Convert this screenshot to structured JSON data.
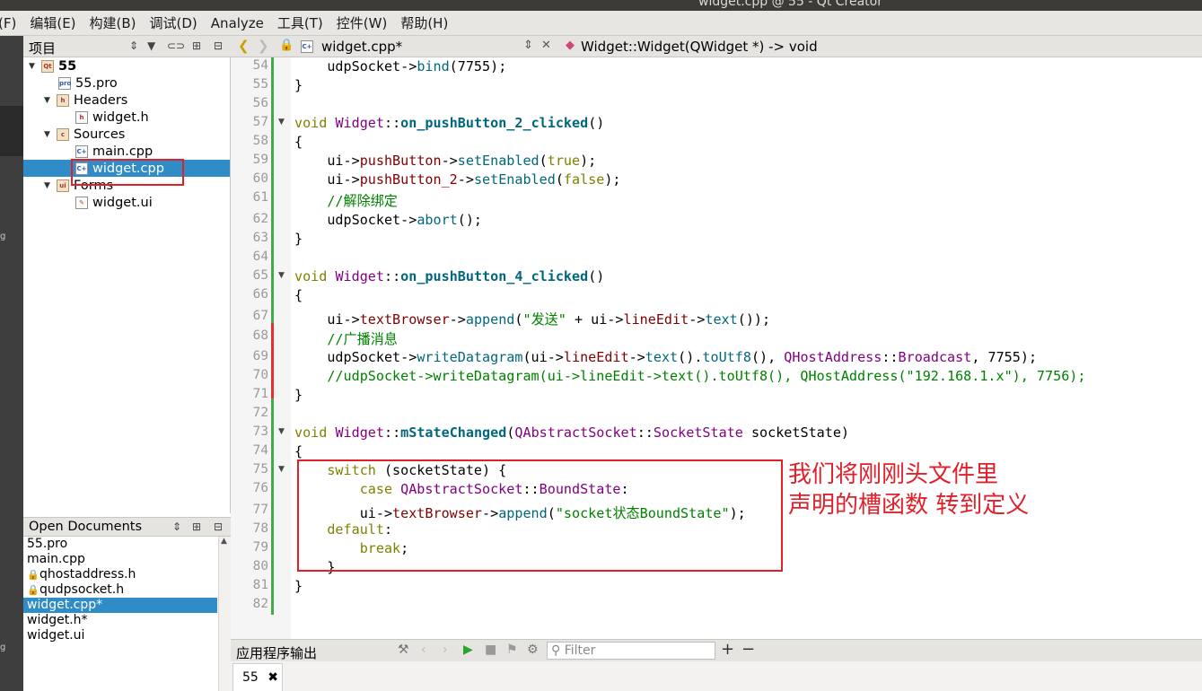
{
  "window": {
    "title": "widget.cpp @ 55 - Qt Creator"
  },
  "menu": [
    "(F)",
    "编辑(E)",
    "构建(B)",
    "调试(D)",
    "Analyze",
    "工具(T)",
    "控件(W)",
    "帮助(H)"
  ],
  "mode_bar": {
    "labels": [
      "g",
      "g"
    ]
  },
  "project_pane": {
    "title": "项目",
    "tree": [
      {
        "label": "55",
        "kind": "project"
      },
      {
        "label": "55.pro",
        "kind": "pro"
      },
      {
        "label": "Headers",
        "kind": "folder"
      },
      {
        "label": "widget.h",
        "kind": "header"
      },
      {
        "label": "Sources",
        "kind": "folder"
      },
      {
        "label": "main.cpp",
        "kind": "source"
      },
      {
        "label": "widget.cpp",
        "kind": "source",
        "selected": true
      },
      {
        "label": "Forms",
        "kind": "folder"
      },
      {
        "label": "widget.ui",
        "kind": "form"
      }
    ]
  },
  "open_documents": {
    "title": "Open Documents",
    "items": [
      {
        "label": "55.pro",
        "locked": false
      },
      {
        "label": "main.cpp",
        "locked": false
      },
      {
        "label": "qhostaddress.h",
        "locked": true
      },
      {
        "label": "qudpsocket.h",
        "locked": true
      },
      {
        "label": "widget.cpp*",
        "locked": false,
        "selected": true
      },
      {
        "label": "widget.h*",
        "locked": false
      },
      {
        "label": "widget.ui",
        "locked": false
      }
    ]
  },
  "editor": {
    "file_name": "widget.cpp*",
    "function_locator": "Widget::Widget(QWidget *) -> void",
    "line_numbers": [
      "54",
      "55",
      "56",
      "57",
      "58",
      "59",
      "60",
      "61",
      "62",
      "63",
      "64",
      "65",
      "66",
      "67",
      "68",
      "69",
      "70",
      "71",
      "72",
      "73",
      "74",
      "75",
      "76",
      "77",
      "78",
      "79",
      "80",
      "81",
      "82"
    ],
    "lines": {
      "l54_a": "    udpSocket->",
      "l54_b": "bind",
      "l54_c": "(7755);",
      "l55": "}",
      "l57_a": "void",
      "l57_b": " Widget",
      "l57_c": "::",
      "l57_d": "on_pushButton_2_clicked",
      "l57_e": "()",
      "l58": "{",
      "l59_a": "    ui->",
      "l59_b": "pushButton",
      "l59_c": "->",
      "l59_d": "setEnabled",
      "l59_e": "(",
      "l59_f": "true",
      "l59_g": ");",
      "l60_a": "    ui->",
      "l60_b": "pushButton_2",
      "l60_c": "->",
      "l60_d": "setEnabled",
      "l60_e": "(",
      "l60_f": "false",
      "l60_g": ");",
      "l61": "    //解除绑定",
      "l62_a": "    udpSocket->",
      "l62_b": "abort",
      "l62_c": "();",
      "l63": "}",
      "l65_a": "void",
      "l65_b": " Widget",
      "l65_c": "::",
      "l65_d": "on_pushButton_4_clicked",
      "l65_e": "()",
      "l66": "{",
      "l67_a": "    ui->",
      "l67_b": "textBrowser",
      "l67_c": "->",
      "l67_d": "append",
      "l67_e": "(",
      "l67_f": "\"发送\"",
      "l67_g": " + ui->",
      "l67_h": "lineEdit",
      "l67_i": "->",
      "l67_j": "text",
      "l67_k": "());",
      "l68": "    //广播消息",
      "l69_a": "    udpSocket->",
      "l69_b": "writeDatagram",
      "l69_c": "(ui->",
      "l69_d": "lineEdit",
      "l69_e": "->",
      "l69_f": "text",
      "l69_g": "().",
      "l69_h": "toUtf8",
      "l69_i": "(), ",
      "l69_j": "QHostAddress",
      "l69_k": "::",
      "l69_l": "Broadcast",
      "l69_m": ", 7755);",
      "l70": "    //udpSocket->writeDatagram(ui->lineEdit->text().toUtf8(), QHostAddress(\"192.168.1.x\"), 7756);",
      "l71": "}",
      "l73_a": "void",
      "l73_b": " Widget",
      "l73_c": "::",
      "l73_d": "mStateChanged",
      "l73_e": "(",
      "l73_f": "QAbstractSocket",
      "l73_g": "::",
      "l73_h": "SocketState",
      "l73_i": " socketState)",
      "l74": "{",
      "l75_a": "    switch",
      "l75_b": " (socketState) {",
      "l76_a": "        case",
      "l76_b": " QAbstractSocket",
      "l76_c": "::",
      "l76_d": "BoundState",
      "l76_e": ":",
      "l77_a": "        ui->",
      "l77_b": "textBrowser",
      "l77_c": "->",
      "l77_d": "append",
      "l77_e": "(",
      "l77_f": "\"socket状态BoundState\"",
      "l77_g": ");",
      "l78_a": "    default",
      "l78_b": ":",
      "l79_a": "        break",
      "l79_b": ";",
      "l80": "    }",
      "l81": "}"
    }
  },
  "annotation": {
    "line1": "我们将刚刚头文件里",
    "line2": "声明的槽函数 转到定义"
  },
  "output_pane": {
    "title": "应用程序输出",
    "filter_placeholder": "Filter",
    "tab_label": "55"
  },
  "icons": {
    "back": "chevron-left-icon",
    "forward": "chevron-right-icon",
    "lock": "lock-icon",
    "close": "close-icon",
    "filter": "filter-icon",
    "link": "link-icon",
    "split": "split-icon"
  },
  "colors": {
    "selection": "#308cc6",
    "keyword": "#808000",
    "function": "#00677c",
    "class": "#800080",
    "member": "#800000",
    "string": "#008000",
    "annotation": "#e0202a"
  }
}
